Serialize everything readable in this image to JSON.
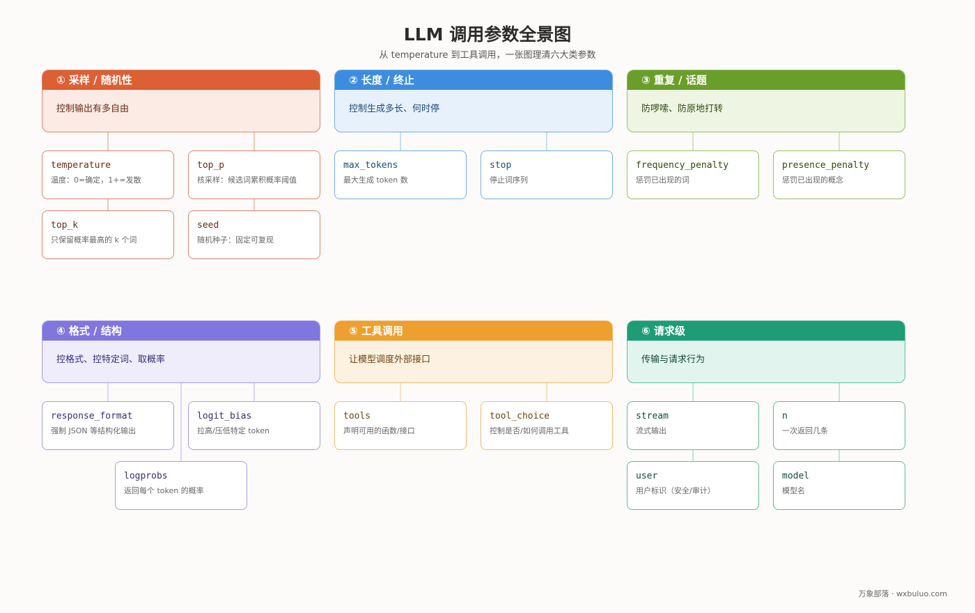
{
  "title": "LLM 调用参数全景图",
  "subtitle": "从 temperature 到工具调用，一张图理清六大类参数",
  "footer": "万象部落 · wxbuluo.com",
  "groups": [
    {
      "title": "① 采样 / 随机性",
      "desc": "控制输出有多自由",
      "colors": {
        "header": "#dd5f34",
        "border": "#e2826a",
        "fill": "#fcebe4",
        "text": "#6b2a14",
        "line": "#eda38c"
      },
      "nodes": [
        {
          "name": "temperature",
          "desc": "温度：0=确定，1+=发散"
        },
        {
          "name": "top_p",
          "desc": "核采样：候选词累积概率阈值"
        },
        {
          "name": "top_k",
          "desc": "只保留概率最高的 k 个词"
        },
        {
          "name": "seed",
          "desc": "随机种子：固定可复现"
        }
      ]
    },
    {
      "title": "② 长度 / 终止",
      "desc": "控制生成多长、何时停",
      "colors": {
        "header": "#3c8ddf",
        "border": "#72aee8",
        "fill": "#e7f1fc",
        "text": "#1d4a7a",
        "line": "#a4c9ef"
      },
      "nodes": [
        {
          "name": "max_tokens",
          "desc": "最大生成 token 数"
        },
        {
          "name": "stop",
          "desc": "停止词序列"
        }
      ]
    },
    {
      "title": "③ 重复 / 话题",
      "desc": "防啰嗦、防原地打转",
      "colors": {
        "header": "#6a9e2a",
        "border": "#94c063",
        "fill": "#eef5e3",
        "text": "#2f4a11",
        "line": "#b9d59a"
      },
      "nodes": [
        {
          "name": "frequency_penalty",
          "desc": "惩罚已出现的词"
        },
        {
          "name": "presence_penalty",
          "desc": "惩罚已出现的概念"
        }
      ]
    },
    {
      "title": "④ 格式 / 结构",
      "desc": "控格式、控特定词、取概率",
      "colors": {
        "header": "#7f76de",
        "border": "#a39bea",
        "fill": "#efedfc",
        "text": "#352d7a",
        "line": "#c4bff2"
      },
      "nodes": [
        {
          "name": "response_format",
          "desc": "强制 JSON 等结构化输出"
        },
        {
          "name": "logit_bias",
          "desc": "拉高/压低特定 token"
        },
        {
          "name": "logprobs",
          "desc": "返回每个 token 的概率"
        }
      ]
    },
    {
      "title": "⑤ 工具调用",
      "desc": "让模型调度外部接口",
      "colors": {
        "header": "#ee9f2d",
        "border": "#f2bb6b",
        "fill": "#fdf1e1",
        "text": "#6e4410",
        "line": "#f5d29f"
      },
      "nodes": [
        {
          "name": "tools",
          "desc": "声明可用的函数/接口"
        },
        {
          "name": "tool_choice",
          "desc": "控制是否/如何调用工具"
        }
      ]
    },
    {
      "title": "⑥ 请求级",
      "desc": "传输与请求行为",
      "colors": {
        "header": "#1e9c76",
        "border": "#5bbd9d",
        "fill": "#e2f4ee",
        "text": "#114a39",
        "line": "#98d6c1"
      },
      "nodes": [
        {
          "name": "stream",
          "desc": "流式输出"
        },
        {
          "name": "n",
          "desc": "一次返回几条"
        },
        {
          "name": "user",
          "desc": "用户标识（安全/审计）"
        },
        {
          "name": "model",
          "desc": "模型名"
        }
      ]
    }
  ]
}
